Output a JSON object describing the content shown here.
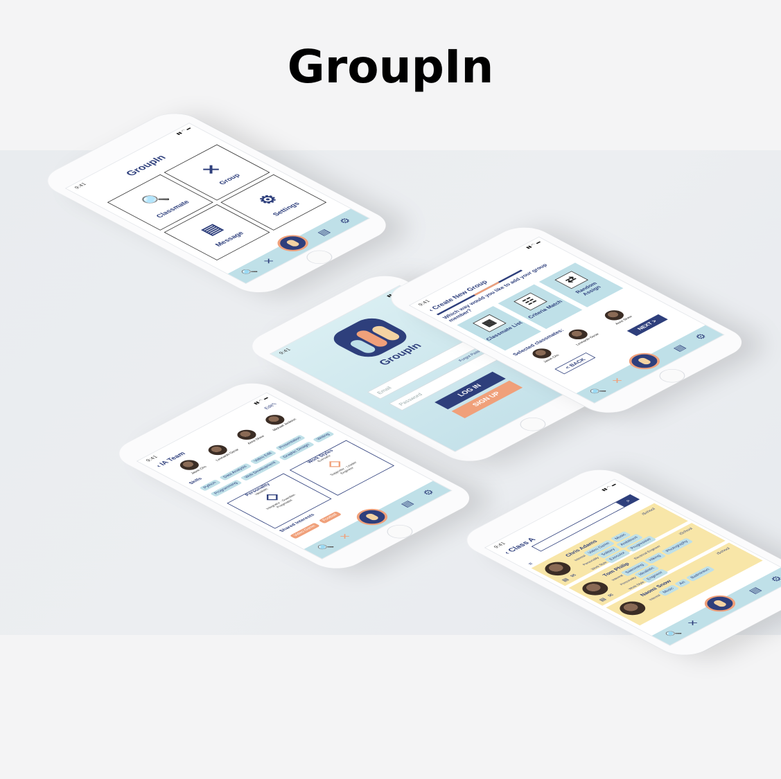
{
  "page": {
    "title": "GroupIn"
  },
  "status_time": "9:41",
  "menu": {
    "app_title": "GroupIn",
    "tiles": [
      "Classmate",
      "Group",
      "Message",
      "Settings"
    ]
  },
  "login": {
    "logo_text": "GroupIn",
    "email_placeholder": "Email",
    "password_placeholder": "Password",
    "forgot_password": "Forgot Password?",
    "login_button": "LOG IN",
    "signup_button": "SIGN UP"
  },
  "create_group": {
    "title": "Create New Group",
    "question": "Which way would you like to add your group member?",
    "options": [
      "Classmate List",
      "Criteria Match",
      "Random Assign"
    ],
    "selected_label": "Selected classmates:",
    "classmates": [
      "Jason Cho",
      "Leonardo Oscar",
      "Anne Shaw"
    ],
    "back_button": "< BACK",
    "next_button": "NEXT >"
  },
  "team": {
    "title": "IA Team",
    "edit": "Edit",
    "members": [
      "Jason Cho",
      "Leonardo Oscar",
      "Anne Shaw",
      "Michael Jackson"
    ],
    "skills_label": "Skills",
    "skills": [
      "Python",
      "Data Analysis",
      "Video Edit",
      "Presentation",
      "Programming",
      "Web Development",
      "Graphic Design",
      "Writing"
    ],
    "personality_label": "Personality",
    "personality_axes": [
      "Idealistic",
      "Guardian",
      "Pragmatist",
      "Integrator"
    ],
    "work_styles_label": "Work Styles",
    "work_style_axes": [
      "Executor",
      "Leader",
      "Engineer",
      "Supporter"
    ],
    "shared_interests_label": "Shared Interests",
    "shared_interests": [
      "Video Game",
      "Football"
    ]
  },
  "class_list": {
    "title": "Class A",
    "cards": [
      {
        "name": "Chris Adams",
        "school": "iSchool",
        "rows": [
          "Interest",
          "Personality",
          "Work Style"
        ],
        "tags": [
          "Video Game",
          "Music",
          "Solitary",
          "Ambitious",
          "Executor",
          "Progressive"
        ]
      },
      {
        "name": "Tom Philip",
        "school": "iSchool",
        "major": "Electrical Engineer",
        "rows": [
          "Interest",
          "Personality",
          "Work Style"
        ],
        "tags": [
          "Swimming",
          "Hiking",
          "Photography",
          "Idealistic",
          "Engineer"
        ]
      },
      {
        "name": "Naomi Snow",
        "school": "iSchool",
        "rows": [
          "Interest"
        ],
        "tags": [
          "Music",
          "Art",
          "Badminton"
        ]
      }
    ]
  },
  "colors": {
    "navy": "#2e3f7c",
    "light_blue": "#bfe0e8",
    "orange": "#f0a07a",
    "yellow": "#f8e6a8"
  },
  "icons": {
    "bottom_nav": [
      "search-icon",
      "group-icon",
      "home-avatar-icon",
      "message-icon",
      "settings-icon"
    ]
  }
}
